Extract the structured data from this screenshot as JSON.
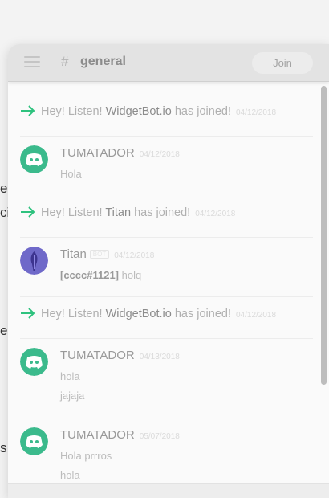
{
  "background_text": [
    "e",
    "ci",
    "e",
    "s"
  ],
  "header": {
    "hash": "#",
    "channel": "general",
    "join_label": "Join"
  },
  "colors": {
    "accent_green": "#2ec27e",
    "discord_avatar": "#3bba8c",
    "titan_avatar": "#6f69c9"
  },
  "messages": [
    {
      "type": "join",
      "prefix": "Hey! Listen! ",
      "user": "WidgetBot.io",
      "suffix": " has joined!",
      "timestamp": "04/12/2018"
    },
    {
      "type": "message",
      "author": "TUMATADOR",
      "timestamp": "04/12/2018",
      "lines": [
        "Hola"
      ],
      "avatar_icon": "discord-icon"
    },
    {
      "type": "join",
      "prefix": "Hey! Listen! ",
      "user": "Titan",
      "suffix": " has joined!",
      "timestamp": "04/12/2018"
    },
    {
      "type": "message",
      "author": "Titan",
      "bot_tag": "BOT",
      "timestamp": "04/12/2018",
      "mention": "[cccc#1121]",
      "text": " holq",
      "avatar_icon": "titan-icon"
    },
    {
      "type": "join",
      "prefix": "Hey! Listen! ",
      "user": "WidgetBot.io",
      "suffix": " has joined!",
      "timestamp": "04/12/2018"
    },
    {
      "type": "message",
      "author": "TUMATADOR",
      "timestamp": "04/13/2018",
      "lines": [
        "hola",
        "jajaja"
      ],
      "avatar_icon": "discord-icon"
    },
    {
      "type": "message",
      "author": "TUMATADOR",
      "timestamp": "05/07/2018",
      "lines": [
        "Hola prrros",
        "hola"
      ],
      "avatar_icon": "discord-icon"
    }
  ]
}
